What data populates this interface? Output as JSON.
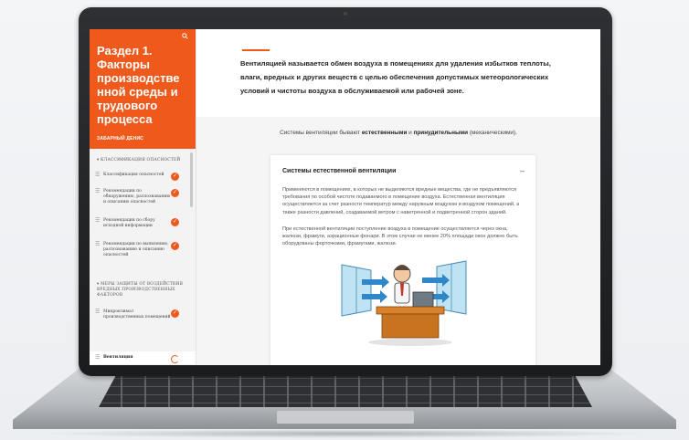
{
  "sidebar": {
    "title": "Раздел 1. Факторы производстве нной среды и трудового процесса",
    "author": "ЗАБАРНЫЙ ДЕНИС",
    "sections": [
      "▾ КЛАССИФИКАЦИЯ ОПАСНОСТЕЙ",
      "▾ МЕРЫ ЗАЩИТЫ ОТ ВОЗДЕЙСТВИЯ ВРЕДНЫХ ПРОИЗВОДСТВЕННЫХ ФАКТОРОВ"
    ],
    "items": [
      {
        "label": "Классификация опасностей",
        "status": "done"
      },
      {
        "label": "Рекомендации по обнаружению, распознаванию и описанию опасностей",
        "status": "done"
      },
      {
        "label": "Рекомендации по сбору исходной информации",
        "status": "done"
      },
      {
        "label": "Рекомендации по выявлению, распознаванию и описанию опасностей",
        "status": "done"
      },
      {
        "label": "Микроклимат производственных помещений",
        "status": "done"
      },
      {
        "label": "Вентиляция",
        "status": "in-progress"
      }
    ]
  },
  "main": {
    "intro": "Вентиляцией называется обмен воздуха в помещениях для удаления избытков теплоты, влаги, вредных и других веществ с целью обеспечения допустимых метеорологических условий и чистоты воздуха в обслуживаемой или рабочей зоне.",
    "types_prefix": "Системы вентиляции бывают ",
    "types_natural": "естественными",
    "types_and": " и ",
    "types_forced": "принудительными",
    "types_suffix": " (механическими).",
    "card": {
      "title": "Системы естественной вентиляции",
      "toggle": "–",
      "p1": "Применяются в помещениях, в которых не выделяются вредные вещества, где не предъявляются требования по особой чистоте подаваемого в помещение воздуха. Естественная вентиляция осуществляется за счет разности температур между наружным воздухом и воздухом помещений, а также разности давлений, создаваемой ветром с наветренной и подветренной сторон зданий.",
      "p2": "При естественной вентиляции поступление воздуха в помещение осуществляется через окна, жалюзи, фрамуги, аэрационные фонари. В этом случае не менее 20% площади окон должно быть оборудованы форточками, фрамугами, жалюзи."
    }
  },
  "colors": {
    "accent": "#ef5a1c",
    "bezel": "#1e1f21"
  },
  "icons": {
    "search": "search-icon",
    "check": "check-icon",
    "progress": "progress-ring-icon",
    "menu": "list-lines-icon"
  }
}
